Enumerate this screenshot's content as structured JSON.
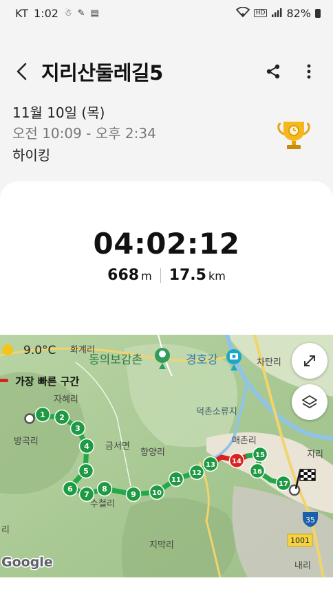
{
  "status_bar": {
    "carrier": "KT",
    "time": "1:02",
    "battery": "82%",
    "icons": [
      "notification-icon",
      "app-icon",
      "gallery-icon",
      "wifi-icon",
      "hd-icon",
      "signal-icon",
      "battery-icon"
    ]
  },
  "header": {
    "title": "지리산둘레길5",
    "icons": [
      "back-icon",
      "share-icon",
      "more-vert-icon"
    ]
  },
  "workout": {
    "date": "11월 10일 (목)",
    "time_range": "오전 10:09 - 오후 2:34",
    "activity": "하이킹",
    "duration": "04:02:12",
    "elevation_value": "668",
    "elevation_unit": "m",
    "distance_value": "17.5",
    "distance_unit": "km",
    "trophy_icon": "trophy-icon"
  },
  "map": {
    "temperature": "9.0°C",
    "legend_fastest": "가장 빠른 구간",
    "provider": "Google",
    "places": {
      "hwagye": "화계리",
      "donguibogam": "동의보감촌",
      "gyeonghogang": "경호강",
      "chatan": "차탄리",
      "jahye": "자혜리",
      "deokchon": "덕촌소류지",
      "banggok": "방곡리",
      "geumseo": "금서면",
      "hyangyang": "향양리",
      "maechon": "매촌리",
      "jiri": "지리",
      "sucheol": "수철리",
      "jimak": "지막리",
      "nae": "내리",
      "ri_left": "리",
      "road_35": "35",
      "road_1001": "1001"
    },
    "markers": [
      "1",
      "2",
      "3",
      "4",
      "5",
      "6",
      "7",
      "8",
      "9",
      "10",
      "11",
      "12",
      "13",
      "14",
      "15",
      "16",
      "17"
    ],
    "colors": {
      "route": "#23a84a",
      "fastest": "#d6231e",
      "marker": "#1f9a43"
    },
    "buttons": [
      "expand-icon",
      "layers-icon"
    ]
  }
}
